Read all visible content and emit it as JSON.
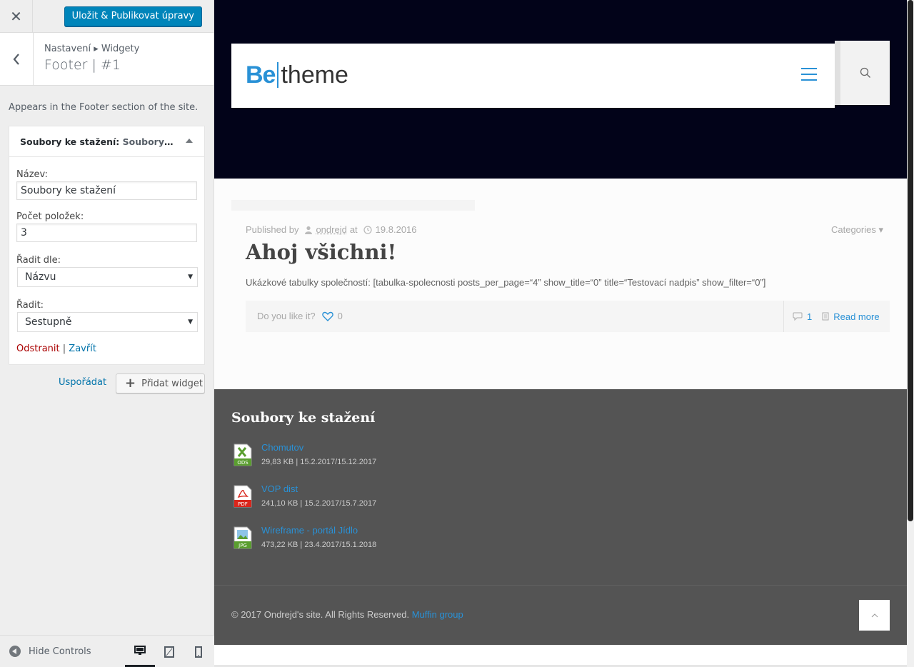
{
  "customizer": {
    "close_label": "✕",
    "publish_label": "Uložit & Publikovat úpravy",
    "breadcrumb": "Nastavení ▸ Widgety",
    "section_title": "Footer | #1",
    "description": "Appears in the Footer section of the site.",
    "widget": {
      "title_bold": "Soubory ke stažení",
      "title_sub": "Soubory ke stažení",
      "fields": {
        "name_label": "Název:",
        "name_value": "Soubory ke stažení",
        "count_label": "Počet položek:",
        "count_value": "3",
        "sort_by_label": "Řadit dle:",
        "sort_by_value": "Názvu",
        "order_label": "Řadit:",
        "order_value": "Sestupně"
      },
      "remove_label": "Odstranit",
      "separator": "|",
      "close_label": "Zavřít"
    },
    "reorder_label": "Uspořádat",
    "add_widget_label": "Přidat widget",
    "hide_controls_label": "Hide Controls"
  },
  "site": {
    "logo_be": "Be",
    "logo_theme": "theme",
    "post": {
      "meta_published_by": "Published by",
      "meta_author": "ondrejd",
      "meta_at": "at",
      "meta_date": "19.8.2016",
      "categories_label": "Categories ▾",
      "title": "Ahoj všichni!",
      "excerpt": "Ukázkové tabulky společností: [tabulka-spolecnosti posts_per_page=“4” show_title=“0” title=“Testovací nadpis” show_filter=“0”]",
      "like_prompt": "Do you like it?",
      "like_count": "0",
      "comment_count": "1",
      "read_more": "Read more"
    },
    "footer": {
      "heading": "Soubory ke stažení",
      "downloads": [
        {
          "name": "Chomutov",
          "meta": "29,83 KB | 15.2.2017/15.12.2017",
          "icon": "ods-file-icon",
          "ext": "ODS",
          "color": "#5a9e2f"
        },
        {
          "name": "VOP dist",
          "meta": "241,10 KB | 15.2.2017/15.7.2017",
          "icon": "pdf-file-icon",
          "ext": "PDF",
          "color": "#d9261c"
        },
        {
          "name": "Wireframe - portál Jídlo",
          "meta": "473,22 KB | 23.4.2017/15.1.2018",
          "icon": "jpg-file-icon",
          "ext": "JPG",
          "color": "#5a9e2f"
        }
      ],
      "copyright_text": "© 2017 Ondrejd's site. All Rights Reserved.",
      "copyright_link": "Muffin group"
    }
  },
  "colors": {
    "accent": "#2991d6",
    "wp_primary": "#0085ba",
    "hero_bg": "#020319",
    "footer_bg": "#545454"
  }
}
